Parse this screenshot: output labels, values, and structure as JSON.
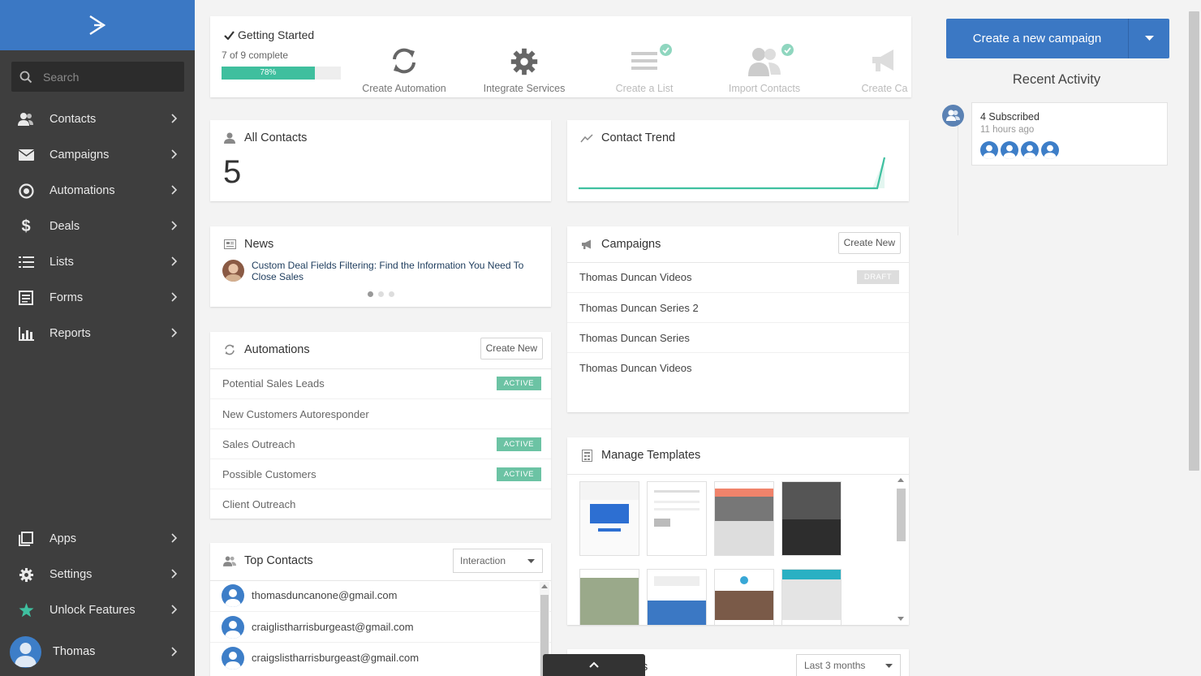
{
  "sidebar": {
    "search_placeholder": "Search",
    "nav": [
      {
        "label": "Contacts",
        "icon": "contacts-icon"
      },
      {
        "label": "Campaigns",
        "icon": "envelope-icon"
      },
      {
        "label": "Automations",
        "icon": "automation-icon"
      },
      {
        "label": "Deals",
        "icon": "dollar-icon"
      },
      {
        "label": "Lists",
        "icon": "list-icon"
      },
      {
        "label": "Forms",
        "icon": "form-icon"
      },
      {
        "label": "Reports",
        "icon": "bar-chart-icon"
      }
    ],
    "bottom_nav": [
      {
        "label": "Apps",
        "icon": "apps-icon"
      },
      {
        "label": "Settings",
        "icon": "gear-icon"
      },
      {
        "label": "Unlock Features",
        "icon": "star-icon"
      }
    ],
    "user": "Thomas"
  },
  "getting_started": {
    "title": "Getting Started",
    "progress_text": "7 of 9 complete",
    "progress_label": "78%",
    "progress_fraction": 0.78,
    "steps": [
      {
        "label": "Create Automation",
        "done": false
      },
      {
        "label": "Integrate Services",
        "done": false
      },
      {
        "label": "Create a List",
        "done": true
      },
      {
        "label": "Import Contacts",
        "done": true
      },
      {
        "label": "Create Ca",
        "done": false
      }
    ]
  },
  "all_contacts": {
    "title": "All Contacts",
    "count": "5"
  },
  "contact_trend": {
    "title": "Contact Trend"
  },
  "news": {
    "title": "News",
    "headline": "Custom Deal Fields Filtering: Find the Information You Need To Close Sales"
  },
  "campaigns": {
    "title": "Campaigns",
    "create_label": "Create New",
    "items": [
      {
        "name": "Thomas Duncan Videos",
        "status": "DRAFT"
      },
      {
        "name": "Thomas Duncan Series 2",
        "status": ""
      },
      {
        "name": "Thomas Duncan Series",
        "status": ""
      },
      {
        "name": "Thomas Duncan Videos",
        "status": ""
      }
    ]
  },
  "automations": {
    "title": "Automations",
    "create_label": "Create New",
    "items": [
      {
        "name": "Potential Sales Leads",
        "status": "ACTIVE"
      },
      {
        "name": "New Customers Autoresponder",
        "status": ""
      },
      {
        "name": "Sales Outreach",
        "status": "ACTIVE"
      },
      {
        "name": "Possible Customers",
        "status": "ACTIVE"
      },
      {
        "name": "Client Outreach",
        "status": ""
      }
    ]
  },
  "templates": {
    "title": "Manage Templates"
  },
  "top_contacts": {
    "title": "Top Contacts",
    "sort_value": "Interaction",
    "items": [
      "thomasduncanone@gmail.com",
      "craiglistharrisburgeast@gmail.com",
      "craigslistharrisburgeast@gmail.com"
    ]
  },
  "bottom_card": {
    "title_fragment": "s",
    "range_value": "Last 3 months"
  },
  "right": {
    "create_campaign": "Create a new campaign",
    "recent_activity_title": "Recent Activity",
    "activity": {
      "title": "4 Subscribed",
      "time": "11 hours ago"
    }
  },
  "colors": {
    "brand_blue": "#3b78c4",
    "sidebar_bg": "#3e3e3e",
    "teal": "#3fc0a0",
    "active_badge": "#6cc3a4"
  }
}
